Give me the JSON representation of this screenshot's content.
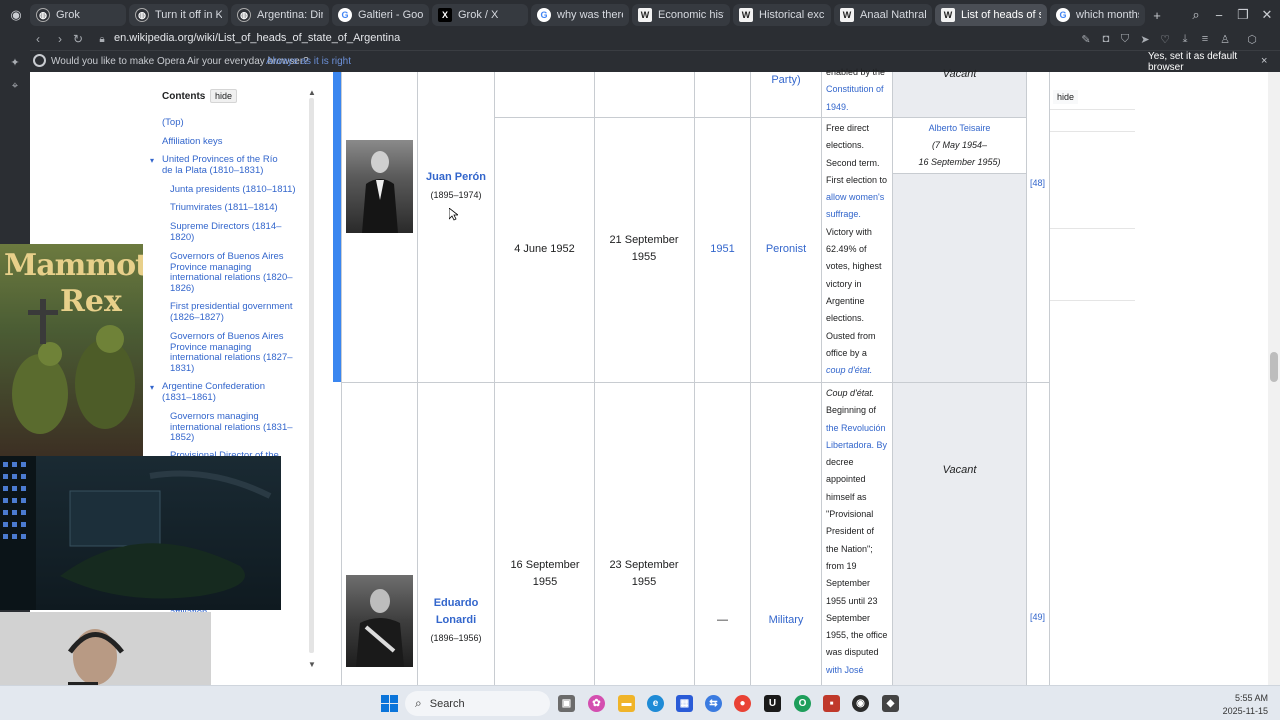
{
  "browser": {
    "tabs": [
      {
        "title": "Grok",
        "favicon": "grok",
        "active": false
      },
      {
        "title": "Turn it off in Korean",
        "favicon": "grok",
        "active": false
      },
      {
        "title": "Argentina: Dirty War",
        "favicon": "grok",
        "active": false
      },
      {
        "title": "Galtieri - Google Se",
        "favicon": "google",
        "active": false
      },
      {
        "title": "Grok / X",
        "favicon": "x",
        "active": false
      },
      {
        "title": "why was there a gra",
        "favicon": "google",
        "active": false
      },
      {
        "title": "Economic history of",
        "favicon": "wiki",
        "active": false
      },
      {
        "title": "Historical exchange",
        "favicon": "wiki",
        "active": false
      },
      {
        "title": "Anaal Nathrakh - W",
        "favicon": "wiki",
        "active": false
      },
      {
        "title": "List of heads of state of",
        "favicon": "wiki",
        "active": true
      },
      {
        "title": "which months did th",
        "favicon": "google",
        "active": false
      }
    ],
    "new_tab": "+",
    "url": "en.wikipedia.org/wiki/List_of_heads_of_state_of_Argentina",
    "prompt": {
      "text": "Would you like to make Opera Air your everyday browser?",
      "link": "Always as it is right",
      "button": "Yes, set it as default browser",
      "close": "×"
    }
  },
  "toc": {
    "heading": "Contents",
    "hide": "hide",
    "items": [
      {
        "label": "(Top)",
        "level": 0
      },
      {
        "label": "Affiliation keys",
        "level": 0
      },
      {
        "label": "United Provinces of the Río de la Plata (1810–1831)",
        "level": 0,
        "expanded": true
      },
      {
        "label": "Junta presidents (1810–1811)",
        "level": 1
      },
      {
        "label": "Triumvirates (1811–1814)",
        "level": 1
      },
      {
        "label": "Supreme Directors (1814–1820)",
        "level": 1
      },
      {
        "label": "Governors of Buenos Aires Province managing international relations (1820–1826)",
        "level": 1
      },
      {
        "label": "First presidential government (1826–1827)",
        "level": 1
      },
      {
        "label": "Governors of Buenos Aires Province managing international relations (1827–1831)",
        "level": 1
      },
      {
        "label": "Argentine Confederation (1831–1861)",
        "level": 0,
        "expanded": true
      },
      {
        "label": "Governors managing international relations (1831–1852)",
        "level": 1
      },
      {
        "label": "Provisional Director of the",
        "level": 1
      },
      {
        "label": "affiliation",
        "level": 1
      }
    ]
  },
  "table": {
    "prev_row": {
      "party_fragment": "Party)",
      "notes_fragment": [
        "enabled by the",
        "Constitution of",
        "1949."
      ],
      "notes_link": "Constitution of 1949",
      "vp": "Vacant"
    },
    "rows": [
      {
        "name": "Juan Perón",
        "years": "(1895–1974)",
        "start": "4 June 1952",
        "end": "21 September 1955",
        "election": "1951",
        "party": "Peronist",
        "notes": [
          "Free direct",
          "elections.",
          "Second term.",
          "First election to",
          "allow women's",
          "suffrage.",
          "Victory with",
          "62.49% of",
          "votes, highest",
          "victory in",
          "Argentine",
          "elections.",
          "Ousted from",
          "office by a",
          "coup d'état."
        ],
        "vp_name": "Alberto Teisaire",
        "vp_dates_start": "(7 May 1954–",
        "vp_dates_end": "16 September 1955)",
        "ref": "[48]"
      },
      {
        "name": "Eduardo Lonardi",
        "name_line1": "Eduardo",
        "name_line2": "Lonardi",
        "years": "(1896–1956)",
        "start": "16 September 1955",
        "end": "23 September 1955",
        "election": "—",
        "party": "Military",
        "notes": [
          "Coup d'état.",
          "Beginning of",
          "the Revolución",
          "Libertadora. By",
          "decree",
          "appointed",
          "himself as",
          "\"Provisional",
          "President of",
          "the Nation\";",
          "from 19",
          "September",
          "1955 until 23",
          "September",
          "1955, the office",
          "was disputed",
          "with José"
        ],
        "vp": "Vacant",
        "ref": "[49]"
      }
    ],
    "right_hide": "hide"
  },
  "overlays": {
    "game_title_1": "Mammoth",
    "game_title_2": "Rex"
  },
  "taskbar": {
    "search_label": "Search",
    "time": "5:55 AM",
    "date": "2025-11-15"
  },
  "colors": {
    "link": "#3366cc",
    "highlight_bar": "#3a86f0",
    "vacant_bg": "#eaecf0",
    "browser_chrome": "#2b2e33"
  }
}
